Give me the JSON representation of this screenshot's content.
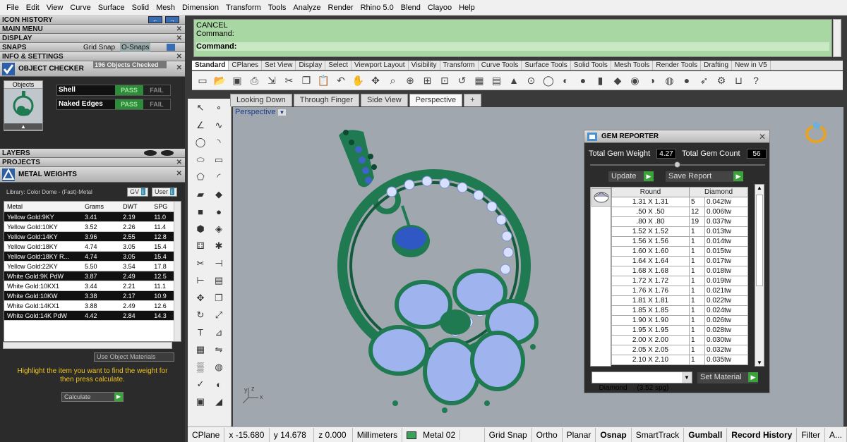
{
  "menu": [
    "File",
    "Edit",
    "View",
    "Curve",
    "Surface",
    "Solid",
    "Mesh",
    "Dimension",
    "Transform",
    "Tools",
    "Analyze",
    "Render",
    "Rhino 5.0",
    "Blend",
    "Clayoo",
    "Help"
  ],
  "left": {
    "sections_top": [
      "ICON HISTORY",
      "MAIN MENU",
      "DISPLAY"
    ],
    "snaps_label": "SNAPS",
    "grid_snap": "Grid Snap",
    "osnaps": "O-Snaps",
    "info": "INFO & SETTINGS",
    "object_checker": {
      "title": "OBJECT CHECKER",
      "count": "196 Objects Checked",
      "objects_label": "Objects",
      "rows": [
        {
          "name": "Shell",
          "pass": "PASS",
          "fail": "FAIL"
        },
        {
          "name": "Naked Edges",
          "pass": "PASS",
          "fail": "FAIL"
        }
      ]
    },
    "layers": "LAYERS",
    "projects": "PROJECTS",
    "metal_weights": {
      "title": "METAL WEIGHTS",
      "library": "Library: Color Dome - (Fast)-Metal",
      "gv": "GV",
      "user": "User",
      "headers": [
        "Metal",
        "Grams",
        "DWT",
        "SPG"
      ],
      "rows": [
        [
          "Yellow Gold:9KY",
          "3.41",
          "2.19",
          "11.0"
        ],
        [
          "Yellow Gold:10KY",
          "3.52",
          "2.26",
          "11.4"
        ],
        [
          "Yellow Gold:14KY",
          "3.96",
          "2.55",
          "12.8"
        ],
        [
          "Yellow Gold:18KY",
          "4.74",
          "3.05",
          "15.4"
        ],
        [
          "Yellow Gold:18KY R...",
          "4.74",
          "3.05",
          "15.4"
        ],
        [
          "Yellow Gold:22KY",
          "5.50",
          "3.54",
          "17.8"
        ],
        [
          "White Gold:9K PdW",
          "3.87",
          "2.49",
          "12.5"
        ],
        [
          "White Gold:10KX1",
          "3.44",
          "2.21",
          "11.1"
        ],
        [
          "White Gold:10KW",
          "3.38",
          "2.17",
          "10.9"
        ],
        [
          "White Gold:14KX1",
          "3.88",
          "2.49",
          "12.6"
        ],
        [
          "White Gold:14K PdW",
          "4.42",
          "2.84",
          "14.3"
        ]
      ],
      "use_materials": "Use Object Materials",
      "hint": "Highlight the item you want to find the weight for then press calculate.",
      "calculate": "Calculate"
    }
  },
  "command": {
    "line1": "CANCEL",
    "line2": "Command:",
    "line3": "Command:"
  },
  "ribbon_tabs": [
    "Standard",
    "CPlanes",
    "Set View",
    "Display",
    "Select",
    "Viewport Layout",
    "Visibility",
    "Transform",
    "Curve Tools",
    "Surface Tools",
    "Solid Tools",
    "Mesh Tools",
    "Render Tools",
    "Drafting",
    "New in V5"
  ],
  "viewport_tabs": [
    "Looking Down",
    "Through Finger",
    "Side View",
    "Perspective"
  ],
  "viewport_label": "Perspective",
  "gem_reporter": {
    "title": "GEM REPORTER",
    "total_weight_label": "Total Gem Weight",
    "total_weight": "4.27",
    "total_count_label": "Total Gem Count",
    "total_count": "56",
    "update": "Update",
    "save_report": "Save Report",
    "headers": [
      "Round",
      "Diamond"
    ],
    "rows": [
      [
        "1.31 X 1.31",
        "5",
        "0.042tw"
      ],
      [
        ".50 X .50",
        "12",
        "0.006tw"
      ],
      [
        ".80 X .80",
        "19",
        "0.037tw"
      ],
      [
        "1.52 X 1.52",
        "1",
        "0.013tw"
      ],
      [
        "1.56 X 1.56",
        "1",
        "0.014tw"
      ],
      [
        "1.60 X 1.60",
        "1",
        "0.015tw"
      ],
      [
        "1.64 X 1.64",
        "1",
        "0.017tw"
      ],
      [
        "1.68 X 1.68",
        "1",
        "0.018tw"
      ],
      [
        "1.72 X 1.72",
        "1",
        "0.019tw"
      ],
      [
        "1.76 X 1.76",
        "1",
        "0.021tw"
      ],
      [
        "1.81 X 1.81",
        "1",
        "0.022tw"
      ],
      [
        "1.85 X 1.85",
        "1",
        "0.024tw"
      ],
      [
        "1.90 X 1.90",
        "1",
        "0.026tw"
      ],
      [
        "1.95 X 1.95",
        "1",
        "0.028tw"
      ],
      [
        "2.00 X 2.00",
        "1",
        "0.030tw"
      ],
      [
        "2.05 X 2.05",
        "1",
        "0.032tw"
      ],
      [
        "2.10 X 2.10",
        "1",
        "0.035tw"
      ]
    ],
    "material": "Diamond     (3.52 spg)",
    "set_material": "Set Material"
  },
  "status": {
    "cplane": "CPlane",
    "x": "x -15.680",
    "y": "y 14.678",
    "z": "z 0.000",
    "units": "Millimeters",
    "layer": "Metal 02",
    "toggles": [
      "Grid Snap",
      "Ortho",
      "Planar",
      "Osnap",
      "SmartTrack",
      "Gumball",
      "Record History",
      "Filter",
      "A..."
    ]
  },
  "axis": {
    "x": "x",
    "y": "y",
    "z": "z"
  },
  "colors": {
    "command_bg": "#a9d7a3",
    "metal": "#1f7a52",
    "gem": "#9fb4ef",
    "layer_swatch": "#3aa05a"
  }
}
